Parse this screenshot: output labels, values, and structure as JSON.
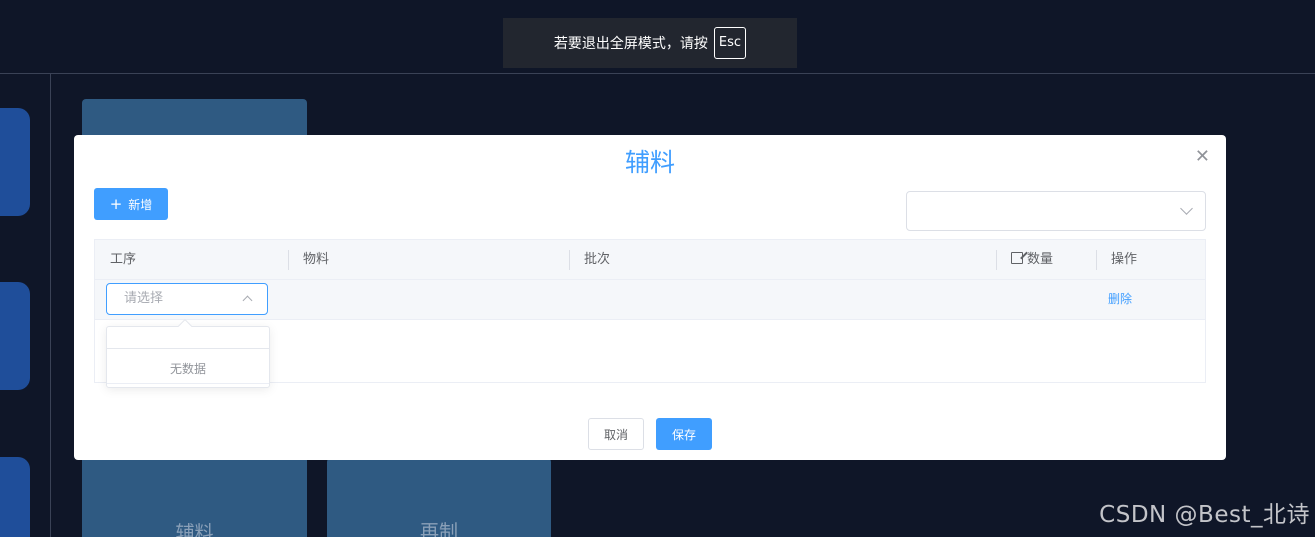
{
  "fullscreen_notice": {
    "text": "若要退出全屏模式，请按",
    "key": "Esc"
  },
  "background": {
    "cards": [
      {
        "label": "辅料"
      },
      {
        "label": "再制"
      }
    ]
  },
  "watermark": "CSDN @Best_北诗",
  "dialog": {
    "title": "辅料",
    "close_icon": "close-icon",
    "add_button": {
      "icon": "plus-icon",
      "label": "新增"
    },
    "top_select": {
      "value": "",
      "icon": "chevron-down-icon"
    },
    "table": {
      "columns": [
        {
          "label": "工序"
        },
        {
          "label": "物料"
        },
        {
          "label": "批次"
        },
        {
          "label": "数量",
          "icon": "edit-icon"
        },
        {
          "label": "操作"
        }
      ],
      "rows": [
        {
          "process_select": {
            "placeholder": "请选择",
            "icon": "chevron-up-icon"
          },
          "action": "删除"
        }
      ]
    },
    "dropdown": {
      "empty_text": "无数据"
    },
    "footer": {
      "cancel": "取消",
      "save": "保存"
    }
  },
  "colors": {
    "primary": "#409eff",
    "background": "#0f1628",
    "card": "#2f5a82",
    "side_tab": "#1f4e9a"
  }
}
